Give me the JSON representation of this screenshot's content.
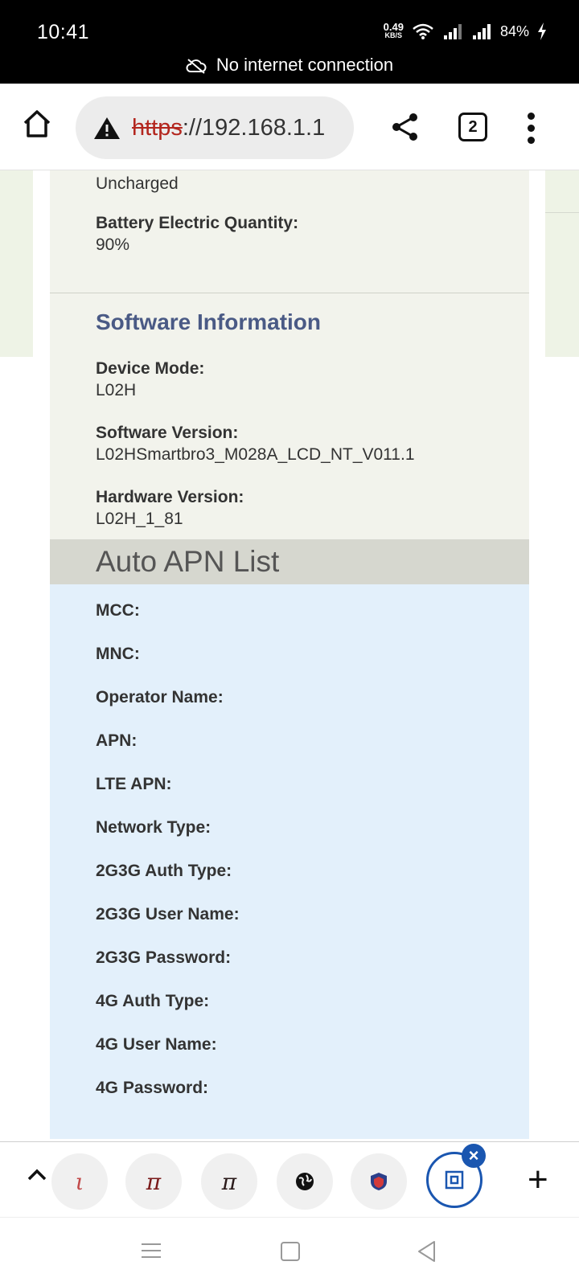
{
  "status_bar": {
    "time": "10:41",
    "net_speed_value": "0.49",
    "net_speed_unit": "KB/S",
    "battery": "84%",
    "notice": "No internet connection"
  },
  "browser": {
    "url_scheme": "https",
    "url_rest": "://192.168.1.1",
    "tab_count": "2"
  },
  "battery_section": {
    "status_value": "Uncharged",
    "quantity_label": "Battery Electric Quantity:",
    "quantity_value": "90%"
  },
  "software_section": {
    "title": "Software Information",
    "fields": [
      {
        "label": "Device Mode:",
        "value": "L02H"
      },
      {
        "label": "Software Version:",
        "value": "L02HSmartbro3_M028A_LCD_NT_V011.1"
      },
      {
        "label": "Hardware Version:",
        "value": "L02H_1_81"
      }
    ]
  },
  "apn_section": {
    "title": "Auto APN List",
    "fields": [
      "MCC:",
      "MNC:",
      "Operator Name:",
      "APN:",
      "LTE APN:",
      "Network Type:",
      "2G3G Auth Type:",
      "2G3G User Name:",
      "2G3G Password:",
      "4G Auth Type:",
      "4G User Name:",
      "4G Password:"
    ]
  },
  "tab_strip": {
    "tab_favicon_1": "ι",
    "tab_favicon_2": "π",
    "tab_favicon_3": "π",
    "icons": [
      "chevron-up-icon",
      "globe-icon",
      "shield-icon",
      "close-icon",
      "plus-icon"
    ]
  },
  "colors": {
    "section_title": "#4a5a85",
    "apn_background": "#e3f0fb",
    "active_tab": "#1a56b0",
    "insecure_scheme": "#b3261e"
  }
}
